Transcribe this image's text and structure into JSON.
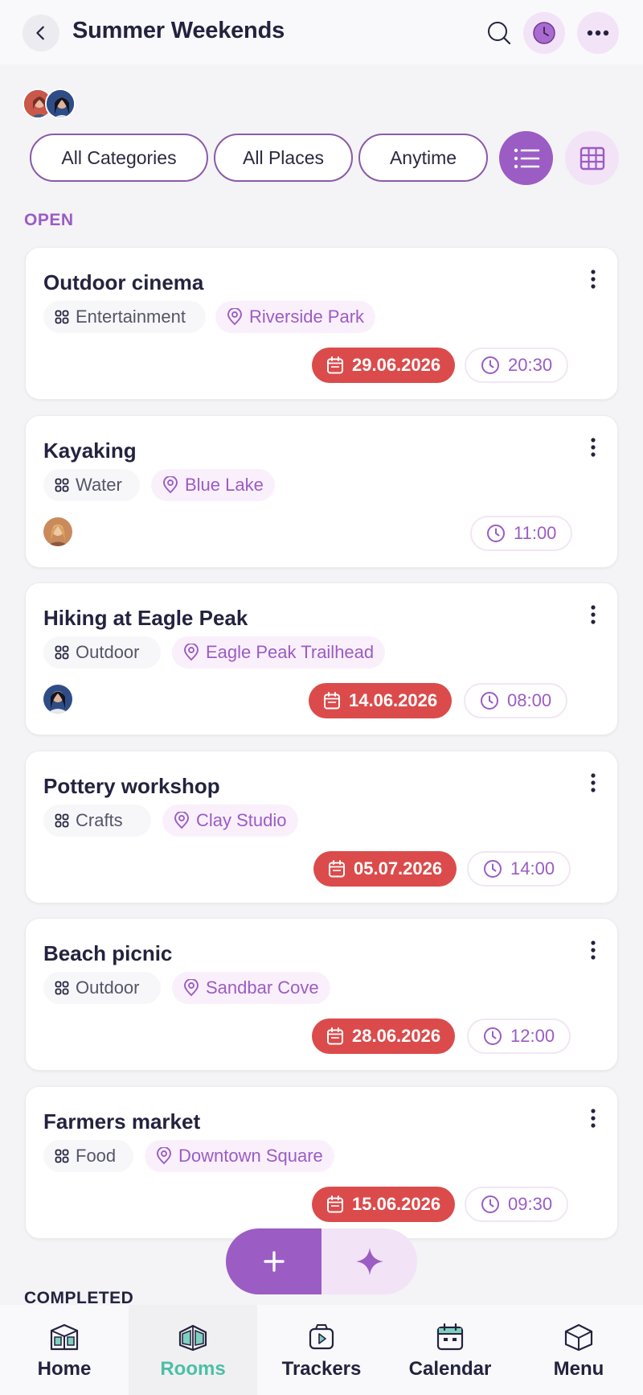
{
  "header": {
    "title": "Summer Weekends",
    "back_icon": "chevron-left-icon",
    "search_icon": "search-icon",
    "clock_icon": "clock-icon",
    "more_icon": "more-horizontal-icon"
  },
  "members": [
    "member-avatar-1",
    "member-avatar-2"
  ],
  "filters": {
    "categories": "All Categories",
    "places": "All Places",
    "time": "Anytime"
  },
  "views": {
    "list_icon": "list-icon",
    "grid_icon": "grid-icon"
  },
  "sections": {
    "open": "OPEN",
    "completed": "COMPLETED"
  },
  "items": [
    {
      "title": "Outdoor cinema",
      "category": "Entertainment",
      "place": "Riverside Park",
      "date": "29.06.2026",
      "time": "20:30",
      "assignee": null
    },
    {
      "title": "Kayaking",
      "category": "Water",
      "place": "Blue Lake",
      "date": null,
      "time": "11:00",
      "assignee": "avatar-blonde"
    },
    {
      "title": "Hiking at Eagle Peak",
      "category": "Outdoor",
      "place": "Eagle Peak Trailhead",
      "date": "14.06.2026",
      "time": "08:00",
      "assignee": "avatar-darkhair"
    },
    {
      "title": "Pottery workshop",
      "category": "Crafts",
      "place": "Clay Studio",
      "date": "05.07.2026",
      "time": "14:00",
      "assignee": null
    },
    {
      "title": "Beach picnic",
      "category": "Outdoor",
      "place": "Sandbar Cove",
      "date": "28.06.2026",
      "time": "12:00",
      "assignee": null
    },
    {
      "title": "Farmers market",
      "category": "Food",
      "place": "Downtown Square",
      "date": "15.06.2026",
      "time": "09:30",
      "assignee": null
    }
  ],
  "fab": {
    "add_icon": "plus-icon",
    "ai_icon": "sparkle-icon"
  },
  "nav": [
    {
      "label": "Home",
      "icon": "home-icon"
    },
    {
      "label": "Rooms",
      "icon": "rooms-icon"
    },
    {
      "label": "Trackers",
      "icon": "trackers-icon"
    },
    {
      "label": "Calendar",
      "icon": "calendar-icon"
    },
    {
      "label": "Menu",
      "icon": "menu-icon"
    }
  ],
  "colors": {
    "accent": "#9b5cc4",
    "accent_light": "#f2e3f7",
    "date_red": "#db4b4b",
    "active_nav": "#4cbfa6"
  }
}
